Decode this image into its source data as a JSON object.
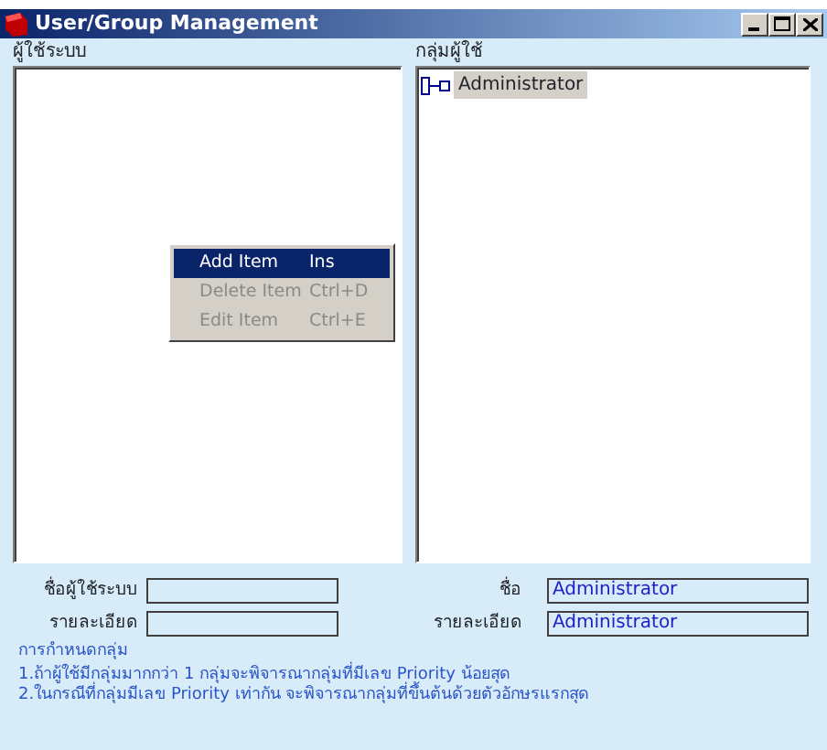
{
  "window": {
    "title": "User/Group Management"
  },
  "users_panel": {
    "label": "ผู้ใช้ระบบ"
  },
  "groups_panel": {
    "label": "กลุ่มผู้ใช้",
    "items": [
      {
        "label": "Administrator",
        "selected": true
      }
    ]
  },
  "context_menu": [
    {
      "label": "Add Item",
      "shortcut": "Ins",
      "selected": true,
      "disabled": false
    },
    {
      "label": "Delete Item",
      "shortcut": "Ctrl+D",
      "selected": false,
      "disabled": true
    },
    {
      "label": "Edit Item",
      "shortcut": "Ctrl+E",
      "selected": false,
      "disabled": true
    }
  ],
  "user_form": [
    {
      "label": "ชื่อผู้ใช้ระบบ"
    },
    {
      "label": "รายละเอียด"
    }
  ],
  "group_form": [
    {
      "label": "ชื่อ",
      "value": "Administrator"
    },
    {
      "label": "รายละเอียด",
      "value": "Administrator"
    }
  ],
  "notes": {
    "title": "การกำหนดกลุ่ม",
    "lines": [
      "1.ถ้าผู้ใช้มีกลุ่มมากกว่า 1 กลุ่มจะพิจารณากลุ่มที่มีเลข Priority น้อยสุด",
      "2.ในกรณีที่กลุ่มมีเลข Priority เท่ากัน  จะพิจารณากลุ่มที่ขึ้นต้นด้วยตัวอักษรแรกสุด"
    ]
  }
}
